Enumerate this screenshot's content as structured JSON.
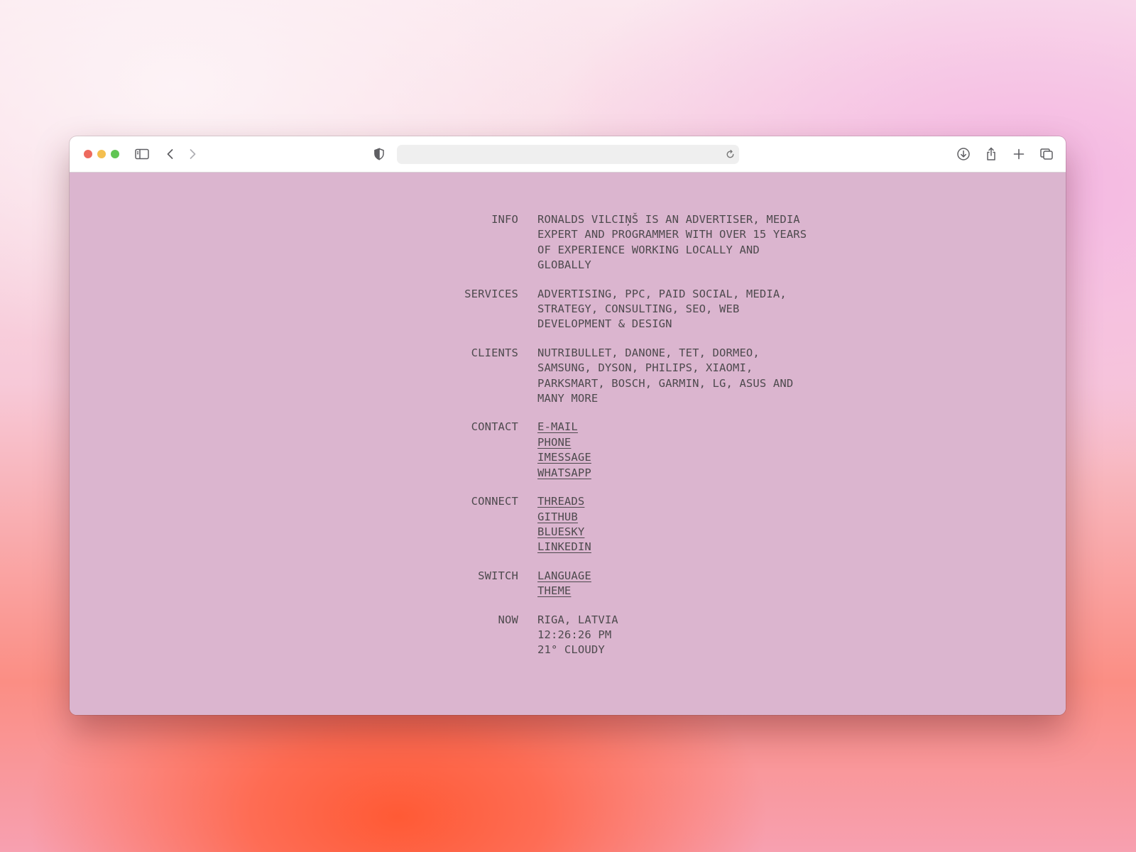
{
  "browser": {
    "toolbar_icons": [
      "sidebar-icon",
      "back-icon",
      "forward-icon",
      "privacy-shield-icon",
      "reload-icon",
      "download-icon",
      "share-icon",
      "new-tab-icon",
      "tab-overview-icon"
    ],
    "url": ""
  },
  "sections": {
    "info": {
      "label": "INFO",
      "lines": [
        "RONALDS VILCIŅŠ IS AN ADVERTISER, MEDIA",
        "EXPERT AND PROGRAMMER WITH OVER 15 YEARS",
        "OF EXPERIENCE WORKING LOCALLY AND",
        "GLOBALLY"
      ]
    },
    "services": {
      "label": "SERVICES",
      "lines": [
        "ADVERTISING, PPC, PAID SOCIAL, MEDIA,",
        "STRATEGY, CONSULTING, SEO, WEB",
        "DEVELOPMENT & DESIGN"
      ]
    },
    "clients": {
      "label": "CLIENTS",
      "lines": [
        "NUTRIBULLET, DANONE, TET, DORMEO,",
        "SAMSUNG, DYSON, PHILIPS, XIAOMI,",
        "PARKSMART, BOSCH, GARMIN, LG, ASUS AND",
        "MANY MORE"
      ]
    },
    "contact": {
      "label": "CONTACT",
      "links": [
        "E-MAIL",
        "PHONE",
        "IMESSAGE",
        "WHATSAPP"
      ]
    },
    "connect": {
      "label": "CONNECT",
      "links": [
        "THREADS",
        "GITHUB",
        "BLUESKY",
        "LINKEDIN"
      ]
    },
    "switch": {
      "label": "SWITCH",
      "links": [
        "LANGUAGE",
        "THEME"
      ]
    },
    "now": {
      "label": "NOW",
      "lines": [
        "RIGA, LATVIA",
        "12:26:26 PM",
        "21° CLOUDY"
      ]
    }
  }
}
